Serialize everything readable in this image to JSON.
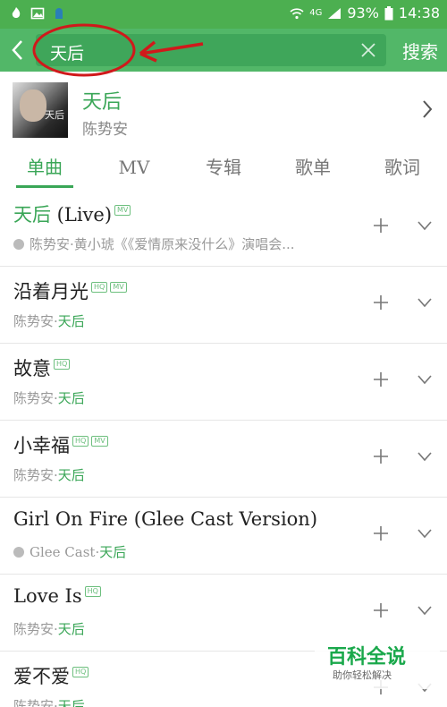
{
  "status_bar": {
    "battery": "93%",
    "time": "14:38",
    "network": "4G",
    "bg_color": "#4caf50"
  },
  "search": {
    "value": "天后",
    "button_label": "搜索",
    "bg_color": "#52b768"
  },
  "artist": {
    "name": "天后",
    "subtitle": "陈势安",
    "avatar_text": "天后"
  },
  "tabs": [
    {
      "label": "单曲",
      "active": true
    },
    {
      "label": "MV",
      "active": false
    },
    {
      "label": "专辑",
      "active": false
    },
    {
      "label": "歌单",
      "active": false
    },
    {
      "label": "歌词",
      "active": false
    }
  ],
  "songs": [
    {
      "title_hl": "天后",
      "title_rest": " (Live)",
      "badges": [
        "MV"
      ],
      "meta_live": true,
      "meta_artist": "陈势安·黄小琥《《爱情原来没什么》演唱会...",
      "meta_album": ""
    },
    {
      "title_hl": "",
      "title_rest": "沿着月光",
      "badges": [
        "HQ",
        "MV"
      ],
      "meta_live": false,
      "meta_artist": "陈势安·",
      "meta_album": "天后"
    },
    {
      "title_hl": "",
      "title_rest": "故意",
      "badges": [
        "HQ"
      ],
      "meta_live": false,
      "meta_artist": "陈势安·",
      "meta_album": "天后"
    },
    {
      "title_hl": "",
      "title_rest": "小幸福",
      "badges": [
        "HQ",
        "MV"
      ],
      "meta_live": false,
      "meta_artist": "陈势安·",
      "meta_album": "天后"
    },
    {
      "title_hl": "",
      "title_rest": "Girl On Fire (Glee Cast Version)",
      "badges": [],
      "meta_live": true,
      "meta_artist": "Glee Cast·",
      "meta_album": "天后"
    },
    {
      "title_hl": "",
      "title_rest": "Love Is",
      "badges": [
        "HQ"
      ],
      "meta_live": false,
      "meta_artist": "陈势安·",
      "meta_album": "天后"
    },
    {
      "title_hl": "",
      "title_rest": "爱不爱",
      "badges": [
        "HQ"
      ],
      "meta_live": false,
      "meta_artist": "陈势安·",
      "meta_album": "天后"
    }
  ],
  "watermark": {
    "title": "百科全说",
    "subtitle": "助你轻松解决"
  },
  "accent_color": "#3aa657",
  "annotation_color": "#d0191b"
}
